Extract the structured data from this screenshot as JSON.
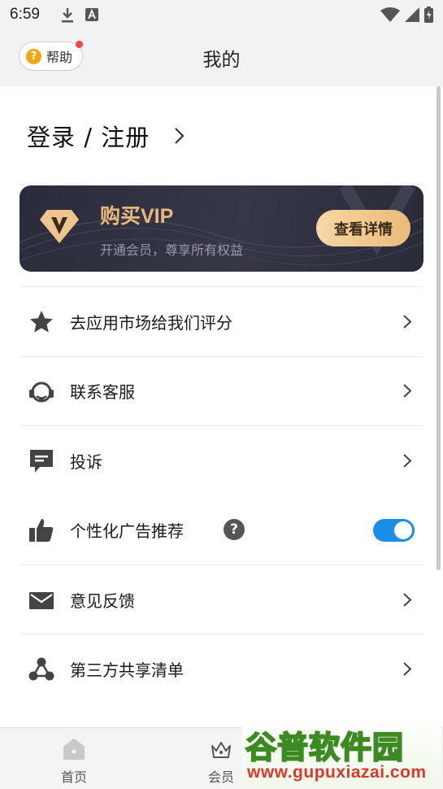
{
  "status_bar": {
    "time": "6:59",
    "left_icons": [
      "download-icon",
      "font-icon"
    ],
    "right_icons": [
      "wifi-icon",
      "signal-icon",
      "battery-icon"
    ]
  },
  "header": {
    "title": "我的",
    "help_label": "帮助"
  },
  "login": {
    "label": "登录 / 注册"
  },
  "vip": {
    "title": "购买VIP",
    "subtitle": "开通会员，尊享所有权益",
    "button": "查看详情"
  },
  "menu": [
    {
      "label": "去应用市场给我们评分",
      "icon": "star-icon"
    },
    {
      "label": "联系客服",
      "icon": "headset-icon"
    },
    {
      "label": "投诉",
      "icon": "message-icon"
    },
    {
      "label": "个性化广告推荐",
      "icon": "thumbs-up-icon",
      "toggle_on": true
    },
    {
      "label": "意见反馈",
      "icon": "mail-icon"
    },
    {
      "label": "第三方共享清单",
      "icon": "share-icon"
    }
  ],
  "bottom_nav": [
    {
      "label": "首页",
      "icon": "home-icon"
    },
    {
      "label": "会员",
      "icon": "crown-icon"
    }
  ],
  "watermark": {
    "title": "谷普软件园",
    "url": "www.gupuxiazai.com"
  },
  "colors": {
    "accent": "#1a8ee9",
    "vip_gold": "#e9b97b",
    "help_yellow": "#f2a812",
    "badge_red": "#f24545"
  }
}
